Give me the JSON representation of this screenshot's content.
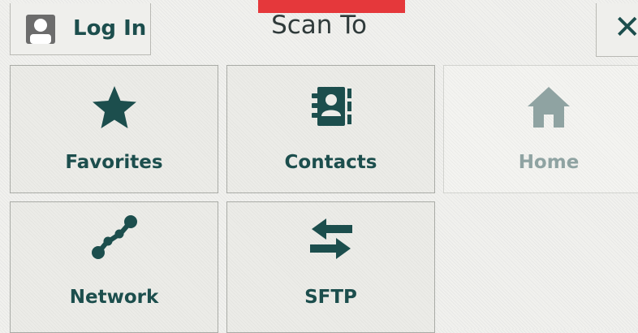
{
  "header": {
    "login_label": "Log In",
    "title": "Scan To",
    "close_glyph": "✕"
  },
  "tiles": [
    {
      "label": "Favorites",
      "icon": "star-icon",
      "enabled": true
    },
    {
      "label": "Contacts",
      "icon": "address-book-icon",
      "enabled": true
    },
    {
      "label": "Home",
      "icon": "home-icon",
      "enabled": false
    },
    {
      "label": "Network",
      "icon": "network-icon",
      "enabled": true
    },
    {
      "label": "SFTP",
      "icon": "transfer-arrows-icon",
      "enabled": true
    }
  ],
  "colors": {
    "accent": "#1c4e4d",
    "disabled": "#8fa3a2",
    "alert": "#e5383b"
  }
}
